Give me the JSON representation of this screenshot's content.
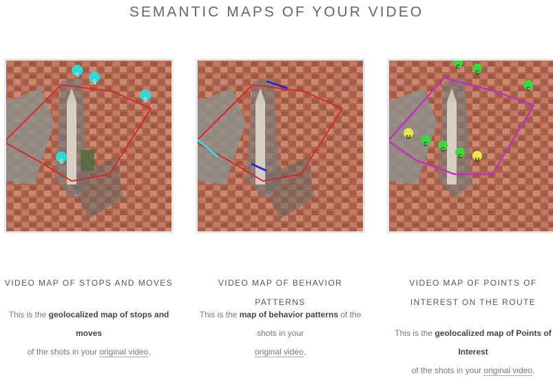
{
  "page": {
    "title": "SEMANTIC MAPS OF YOUR VIDEO"
  },
  "cards": [
    {
      "title": "VIDEO MAP OF STOPS AND MOVES",
      "desc_pre": "This is the ",
      "desc_bold": "geolocalized map of stops and moves",
      "desc_mid": " of the shots in your ",
      "desc_link": "original video",
      "desc_post": ".",
      "markers": [
        {
          "letter": "S",
          "color": "#2fd9d9"
        },
        {
          "letter": "S",
          "color": "#2fd9d9"
        },
        {
          "letter": "S",
          "color": "#2fd9d9"
        },
        {
          "letter": "S",
          "color": "#2fd9d9"
        }
      ]
    },
    {
      "title": "VIDEO MAP OF BEHAVIOR PATTERNS",
      "desc_pre": "This is the ",
      "desc_bold": "map of behavior patterns",
      "desc_mid": " of the shots in your ",
      "desc_link": "original video",
      "desc_post": "."
    },
    {
      "title": "VIDEO MAP OF POINTS OF INTEREST ON THE ROUTE",
      "desc_pre": "This is the ",
      "desc_bold": "geolocalized map of Points of Interest",
      "desc_mid": " of the shots in your ",
      "desc_link": "original video",
      "desc_post": ".",
      "markers": [
        {
          "letter": "C",
          "color": "#3ed83e"
        },
        {
          "letter": "C",
          "color": "#3ed83e"
        },
        {
          "letter": "C",
          "color": "#3ed83e"
        },
        {
          "letter": "C",
          "color": "#3ed83e"
        },
        {
          "letter": "C",
          "color": "#3ed83e"
        },
        {
          "letter": "C",
          "color": "#3ed83e"
        },
        {
          "letter": "M",
          "color": "#e8e84a"
        },
        {
          "letter": "M",
          "color": "#e8e84a"
        }
      ]
    }
  ],
  "colors": {
    "route_red": "#d42a2a",
    "route_cyan": "#3fd6d6",
    "route_blue": "#2a2ad0",
    "route_magenta": "#c030c0"
  }
}
